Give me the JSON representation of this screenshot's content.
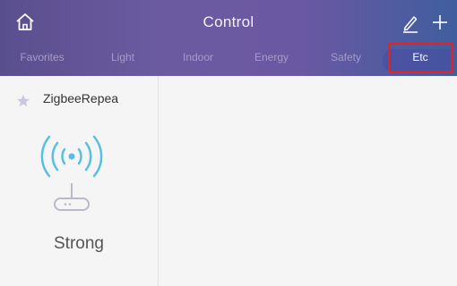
{
  "header": {
    "title": "Control",
    "home_icon": "home-icon",
    "edit_icon": "pencil-icon",
    "add_icon": "plus-icon"
  },
  "tabs": [
    {
      "label": "Favorites",
      "active": false
    },
    {
      "label": "Light",
      "active": false
    },
    {
      "label": "Indoor",
      "active": false
    },
    {
      "label": "Energy",
      "active": false
    },
    {
      "label": "Safety",
      "active": false
    },
    {
      "label": "Etc",
      "active": true
    }
  ],
  "device": {
    "name": "ZigbeeRepea",
    "favorite_icon": "star-icon",
    "icon": "wifi-router-icon",
    "status": "Strong"
  },
  "colors": {
    "header_gradient_start": "#5a4f8e",
    "header_gradient_end": "#3f5e9e",
    "inactive_tab": "#a59cc8",
    "active_tab": "#ffffff",
    "signal_waves": "#55c0e3",
    "highlight_outline": "#e8211e",
    "background": "#f5f5f5"
  }
}
